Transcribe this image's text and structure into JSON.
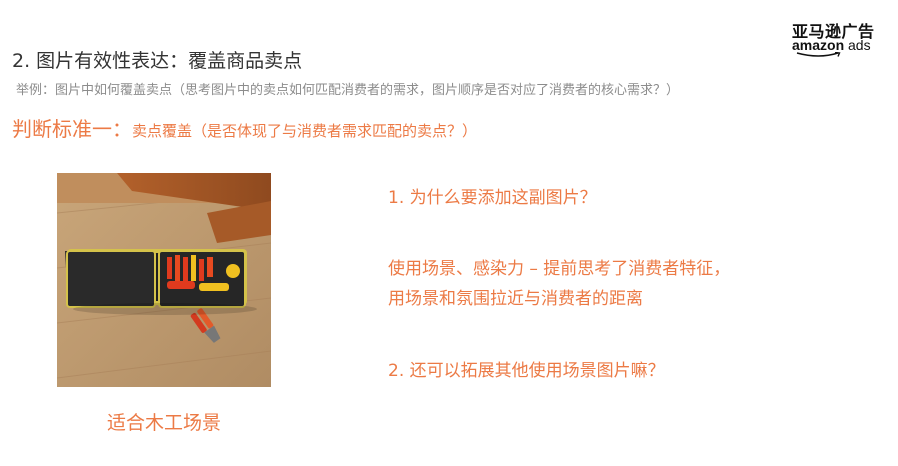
{
  "logo": {
    "cn": "亚马逊广告",
    "en_bold": "amazon",
    "en_light": " ads"
  },
  "title": "2. 图片有效性表达：覆盖商品卖点",
  "example": "举例：图片中如何覆盖卖点（思考图片中的卖点如何匹配消费者的需求，图片顺序是否对应了消费者的核心需求？）",
  "criterion": {
    "main": "判断标准一：",
    "sub": "卖点覆盖（是否体现了与消费者需求匹配的卖点？）"
  },
  "image_caption": "适合木工场景",
  "right": {
    "question1": "1. 为什么要添加这副图片？",
    "answer1_line1": "使用场景、感染力 – 提前思考了消费者特征，",
    "answer1_line2": "用场景和氛围拉近与消费者的距离",
    "question2": "2. 还可以拓展其他使用场景图片嘛？"
  },
  "colors": {
    "accent": "#ec7a45",
    "title": "#333333",
    "muted": "#8c8c8c"
  }
}
